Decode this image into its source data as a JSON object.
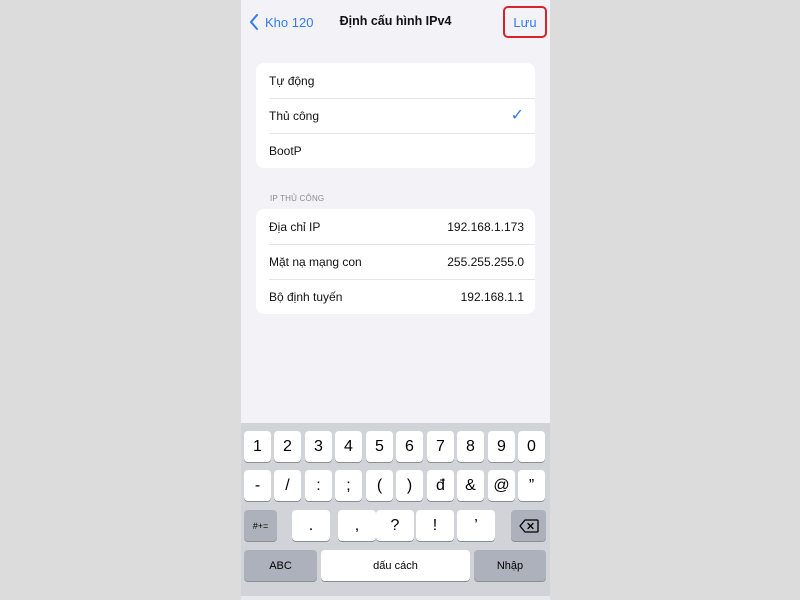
{
  "nav": {
    "back_label": "Kho 120",
    "title": "Định cấu hình IPv4",
    "save_label": "Lưu"
  },
  "config_options": [
    {
      "label": "Tự động",
      "selected": false
    },
    {
      "label": "Thủ công",
      "selected": true
    },
    {
      "label": "BootP",
      "selected": false
    }
  ],
  "check_glyph": "✓",
  "manual_ip": {
    "header": "IP THỦ CÔNG",
    "rows": [
      {
        "label": "Địa chỉ IP",
        "value": "192.168.1.173"
      },
      {
        "label": "Mặt nạ mạng con",
        "value": "255.255.255.0"
      },
      {
        "label": "Bộ định tuyến",
        "value": "192.168.1.1"
      }
    ]
  },
  "keyboard": {
    "row1": [
      "1",
      "2",
      "3",
      "4",
      "5",
      "6",
      "7",
      "8",
      "9",
      "0"
    ],
    "row2": [
      "-",
      "/",
      ":",
      ";",
      "(",
      ")",
      "đ",
      "&",
      "@",
      "”"
    ],
    "row3_mode": "#+=",
    "row3": [
      ".",
      ",",
      "?",
      "!",
      "’"
    ],
    "backspace_icon": "backspace-icon",
    "abc": "ABC",
    "space": "dấu cách",
    "enter": "Nhập"
  },
  "colors": {
    "accent": "#2f7cf6",
    "highlight_border": "#d6232e",
    "background": "#f2f2f7"
  }
}
